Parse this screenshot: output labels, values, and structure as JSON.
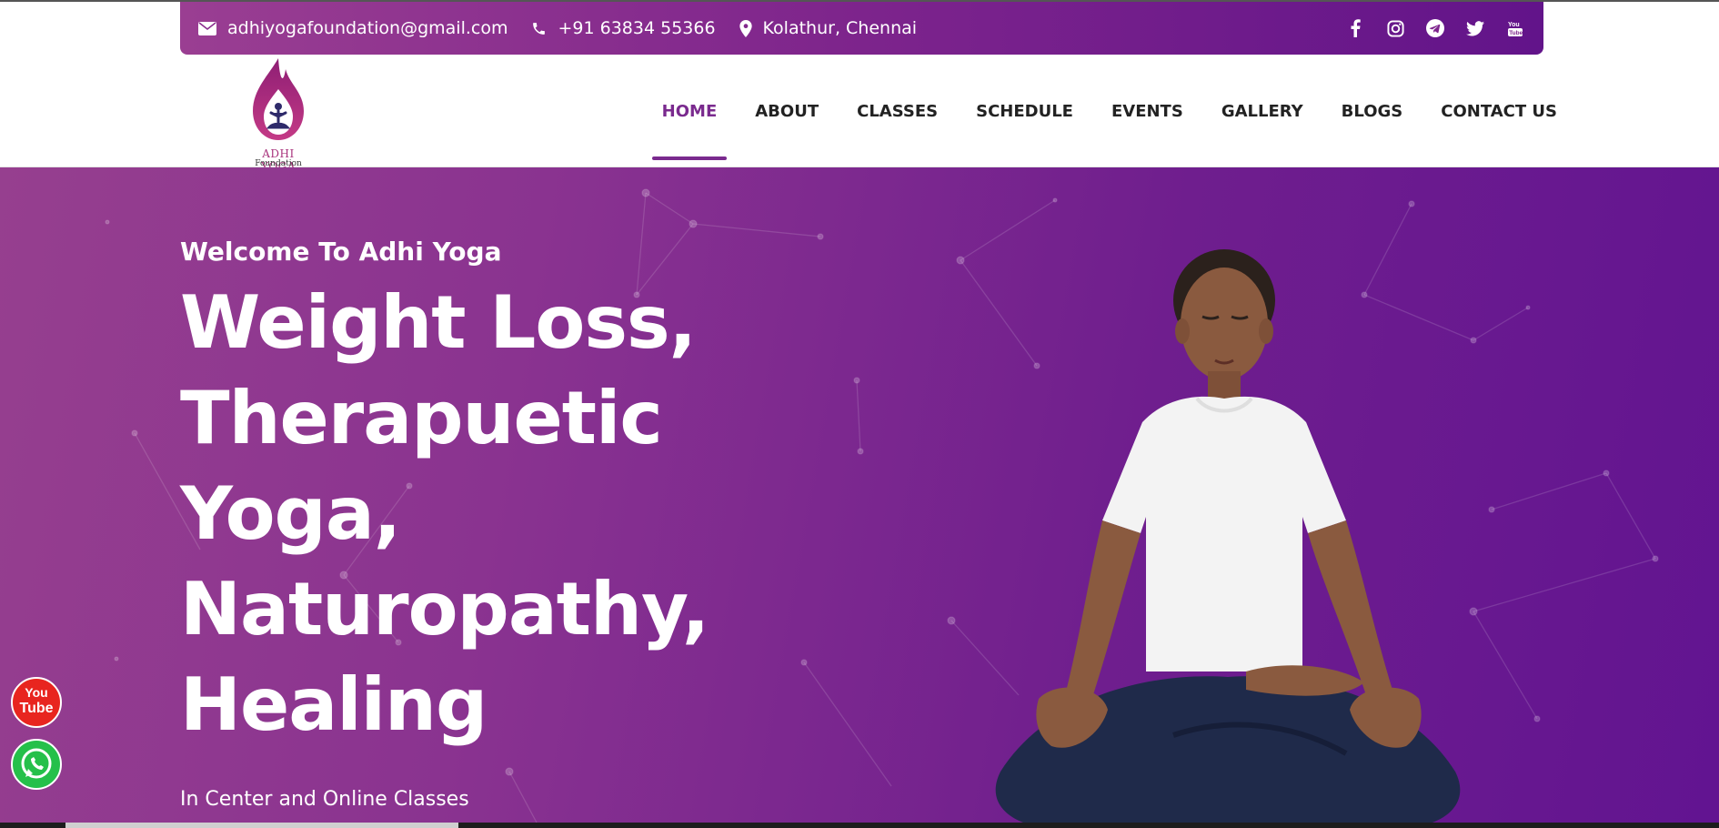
{
  "topbar": {
    "email": "adhiyogafoundation@gmail.com",
    "phone": "+91 63834 55366",
    "location": "Kolathur, Chennai",
    "icons": {
      "email": "envelope-icon",
      "phone": "phone-icon",
      "location": "map-pin-icon"
    },
    "socials": [
      "facebook-icon",
      "instagram-icon",
      "telegram-icon",
      "twitter-icon",
      "youtube-icon"
    ]
  },
  "logo": {
    "name": "ADHI YOGA",
    "sub": "Foundation"
  },
  "nav": {
    "items": [
      {
        "label": "HOME",
        "active": true
      },
      {
        "label": "ABOUT"
      },
      {
        "label": "CLASSES"
      },
      {
        "label": "SCHEDULE"
      },
      {
        "label": "EVENTS"
      },
      {
        "label": "GALLERY"
      },
      {
        "label": "BLOGS"
      },
      {
        "label": "CONTACT US"
      }
    ]
  },
  "hero": {
    "kicker": "Welcome To Adhi Yoga",
    "title_lines": [
      "Weight Loss,",
      "Therapuetic",
      "Yoga,",
      "Naturopathy,",
      "Healing"
    ],
    "subtitle": "In Center and Online Classes"
  },
  "floating": {
    "youtube": {
      "line1": "You",
      "line2": "Tube"
    },
    "whatsapp": "whatsapp-icon"
  },
  "colors": {
    "brand": "#7a2a8e",
    "topbar_start": "#9a3e92",
    "topbar_end": "#62148a",
    "hero_start": "#963f8f",
    "hero_end": "#621491"
  }
}
